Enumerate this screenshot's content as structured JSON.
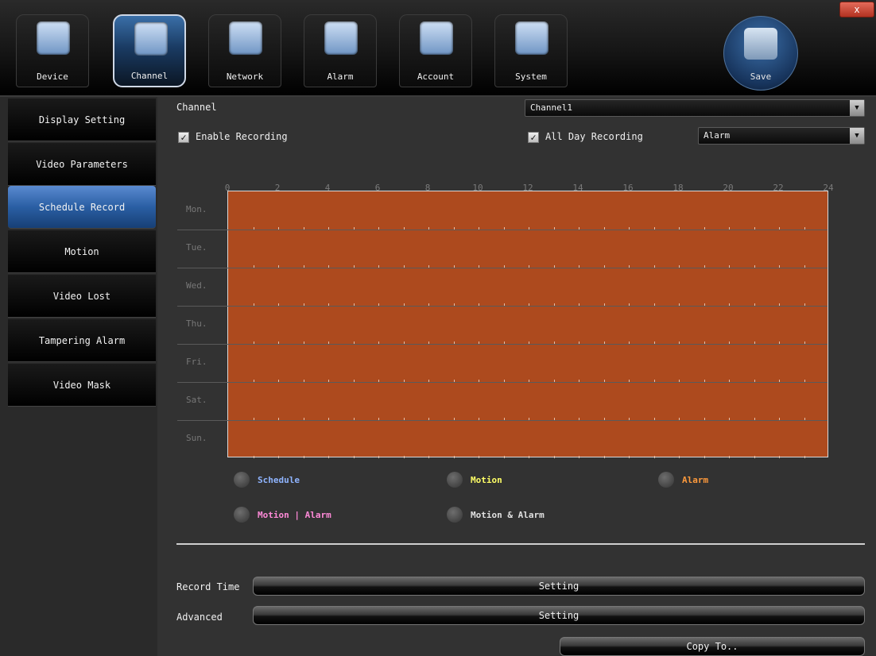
{
  "toolbar": {
    "tabs": [
      {
        "label": "Device",
        "icon": "device-icon"
      },
      {
        "label": "Channel",
        "icon": "channel-icon"
      },
      {
        "label": "Network",
        "icon": "network-icon"
      },
      {
        "label": "Alarm",
        "icon": "alarm-icon"
      },
      {
        "label": "Account",
        "icon": "account-icon"
      },
      {
        "label": "System",
        "icon": "system-icon"
      }
    ],
    "active_tab": "Channel",
    "save_label": "Save",
    "close_label": "x"
  },
  "sidebar": {
    "items": [
      {
        "label": "Display Setting"
      },
      {
        "label": "Video Parameters"
      },
      {
        "label": "Schedule Record"
      },
      {
        "label": "Motion"
      },
      {
        "label": "Video Lost"
      },
      {
        "label": "Tampering Alarm"
      },
      {
        "label": "Video Mask"
      }
    ],
    "active_item": "Schedule Record"
  },
  "main": {
    "channel_label": "Channel",
    "channel_value": "Channel1",
    "enable_recording": {
      "label": "Enable Recording",
      "checked": true
    },
    "all_day_recording": {
      "label": "All Day Recording",
      "checked": true
    },
    "record_type_value": "Alarm",
    "schedule": {
      "hours": [
        "0",
        "2",
        "4",
        "6",
        "8",
        "10",
        "12",
        "14",
        "16",
        "18",
        "20",
        "22",
        "24"
      ],
      "days": [
        "Mon.",
        "Tue.",
        "Wed.",
        "Thu.",
        "Fri.",
        "Sat.",
        "Sun."
      ],
      "fill_color": "#ad4a1e"
    },
    "legend": [
      {
        "label": "Schedule",
        "color": "#8fb4ff"
      },
      {
        "label": "Motion",
        "color": "#ffff66"
      },
      {
        "label": "Alarm",
        "color": "#ff9a3c"
      },
      {
        "label": "Motion | Alarm",
        "color": "#ff8ad8"
      },
      {
        "label": "Motion & Alarm",
        "color": "#e0e0e0"
      }
    ],
    "record_time_label": "Record Time",
    "record_time_button": "Setting",
    "advanced_label": "Advanced",
    "advanced_button": "Setting",
    "copy_button": "Copy To.."
  }
}
